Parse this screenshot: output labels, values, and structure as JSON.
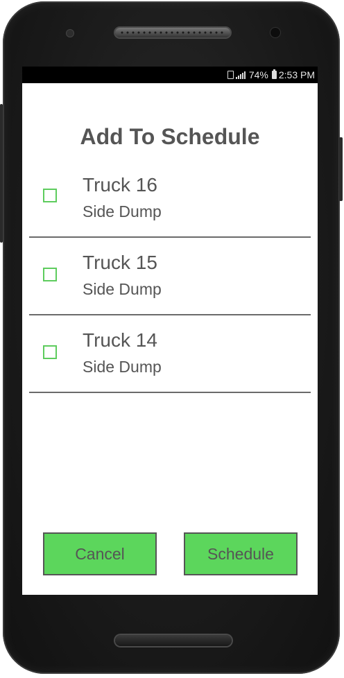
{
  "status_bar": {
    "battery_percent": "74%",
    "time": "2:53 PM",
    "icons": [
      "sim-icon",
      "signal-icon",
      "battery-icon"
    ]
  },
  "dialog": {
    "title": "Add To Schedule",
    "items": [
      {
        "name": "Truck 16",
        "type": "Side Dump",
        "checked": false
      },
      {
        "name": "Truck 15",
        "type": "Side Dump",
        "checked": false
      },
      {
        "name": "Truck 14",
        "type": "Side Dump",
        "checked": false
      }
    ],
    "cancel_label": "Cancel",
    "schedule_label": "Schedule"
  },
  "colors": {
    "accent_green": "#5cd65c",
    "checkbox_green": "#5dcc5d",
    "text_gray": "#555555",
    "divider": "#6a6a6a"
  }
}
